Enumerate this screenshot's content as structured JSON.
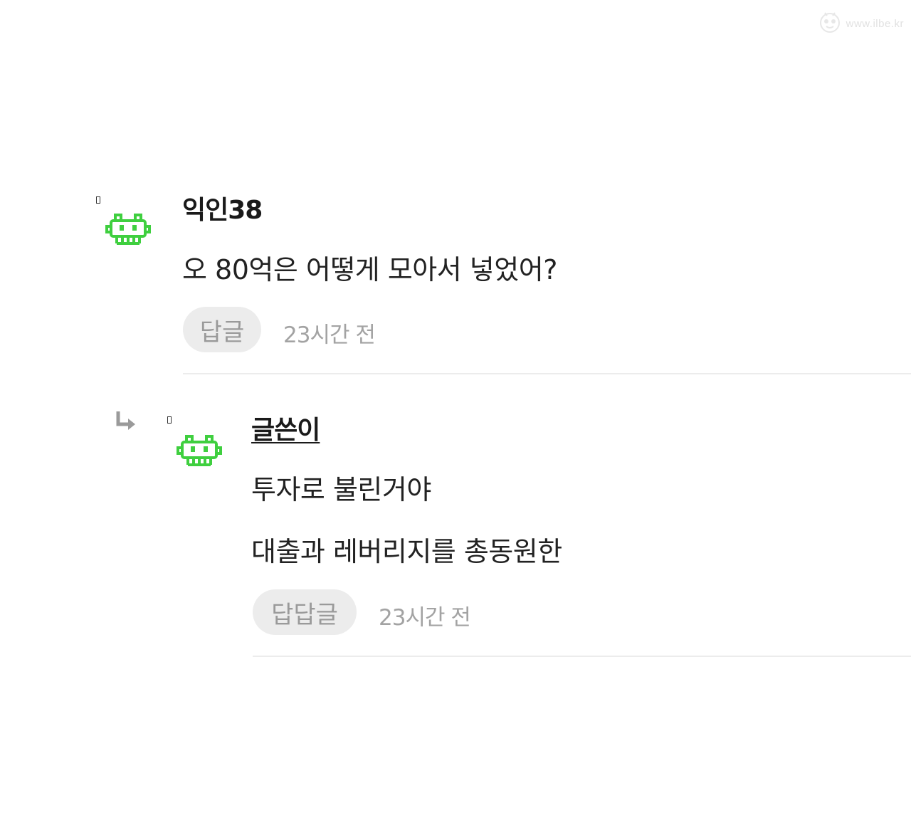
{
  "watermark": {
    "icon": "mascot-icon",
    "text": "www.ilbe.kr"
  },
  "comments": [
    {
      "author": "익인38",
      "lines": [
        "오 80억은 어떻게 모아서 넣었어?"
      ],
      "reply_label": "답글",
      "time": "23시간 전",
      "avatar_icon": "green-pixel-avatar-icon"
    },
    {
      "author": "글쓴이",
      "is_reply": true,
      "lines": [
        "투자로 불린거야",
        "대출과 레버리지를 총동원한"
      ],
      "reply_label": "답답글",
      "time": "23시간 전",
      "avatar_icon": "green-pixel-avatar-icon"
    }
  ],
  "colors": {
    "avatar_green": "#3fcf3f",
    "button_bg": "#ececec",
    "muted_text": "#a3a3a3"
  }
}
